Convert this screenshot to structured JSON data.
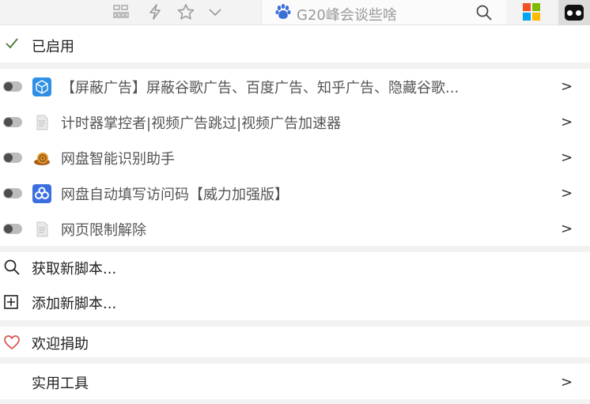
{
  "toolbar": {
    "search_text": "G20峰会谈些啥",
    "icons": [
      "grid-icon",
      "lightning-icon",
      "star-icon",
      "chevron-down-icon",
      "paw-icon",
      "search-icon",
      "windows-logo-icon",
      "tampermonkey-icon"
    ],
    "windows_colors": [
      "#f25022",
      "#7fba00",
      "#00a4ef",
      "#ffb900"
    ]
  },
  "menu": {
    "enabled_label": "已启用",
    "scripts": [
      {
        "name": "【屏蔽广告】屏蔽谷歌广告、百度广告、知乎广告、隐藏谷歌...",
        "icon": "cube-icon",
        "enabled": false
      },
      {
        "name": "计时器掌控者|视频广告跳过|视频广告加速器",
        "icon": "document-icon",
        "enabled": false
      },
      {
        "name": "网盘智能识别助手",
        "icon": "snail-icon",
        "enabled": false
      },
      {
        "name": "网盘自动填写访问码【威力加强版】",
        "icon": "baidu-pan-icon",
        "enabled": false
      },
      {
        "name": "网页限制解除",
        "icon": "document-icon",
        "enabled": false
      }
    ],
    "get_new_scripts": "获取新脚本...",
    "add_new_script": "添加新脚本...",
    "donate": "欢迎捐助",
    "utilities": "实用工具",
    "chevron": ">"
  }
}
